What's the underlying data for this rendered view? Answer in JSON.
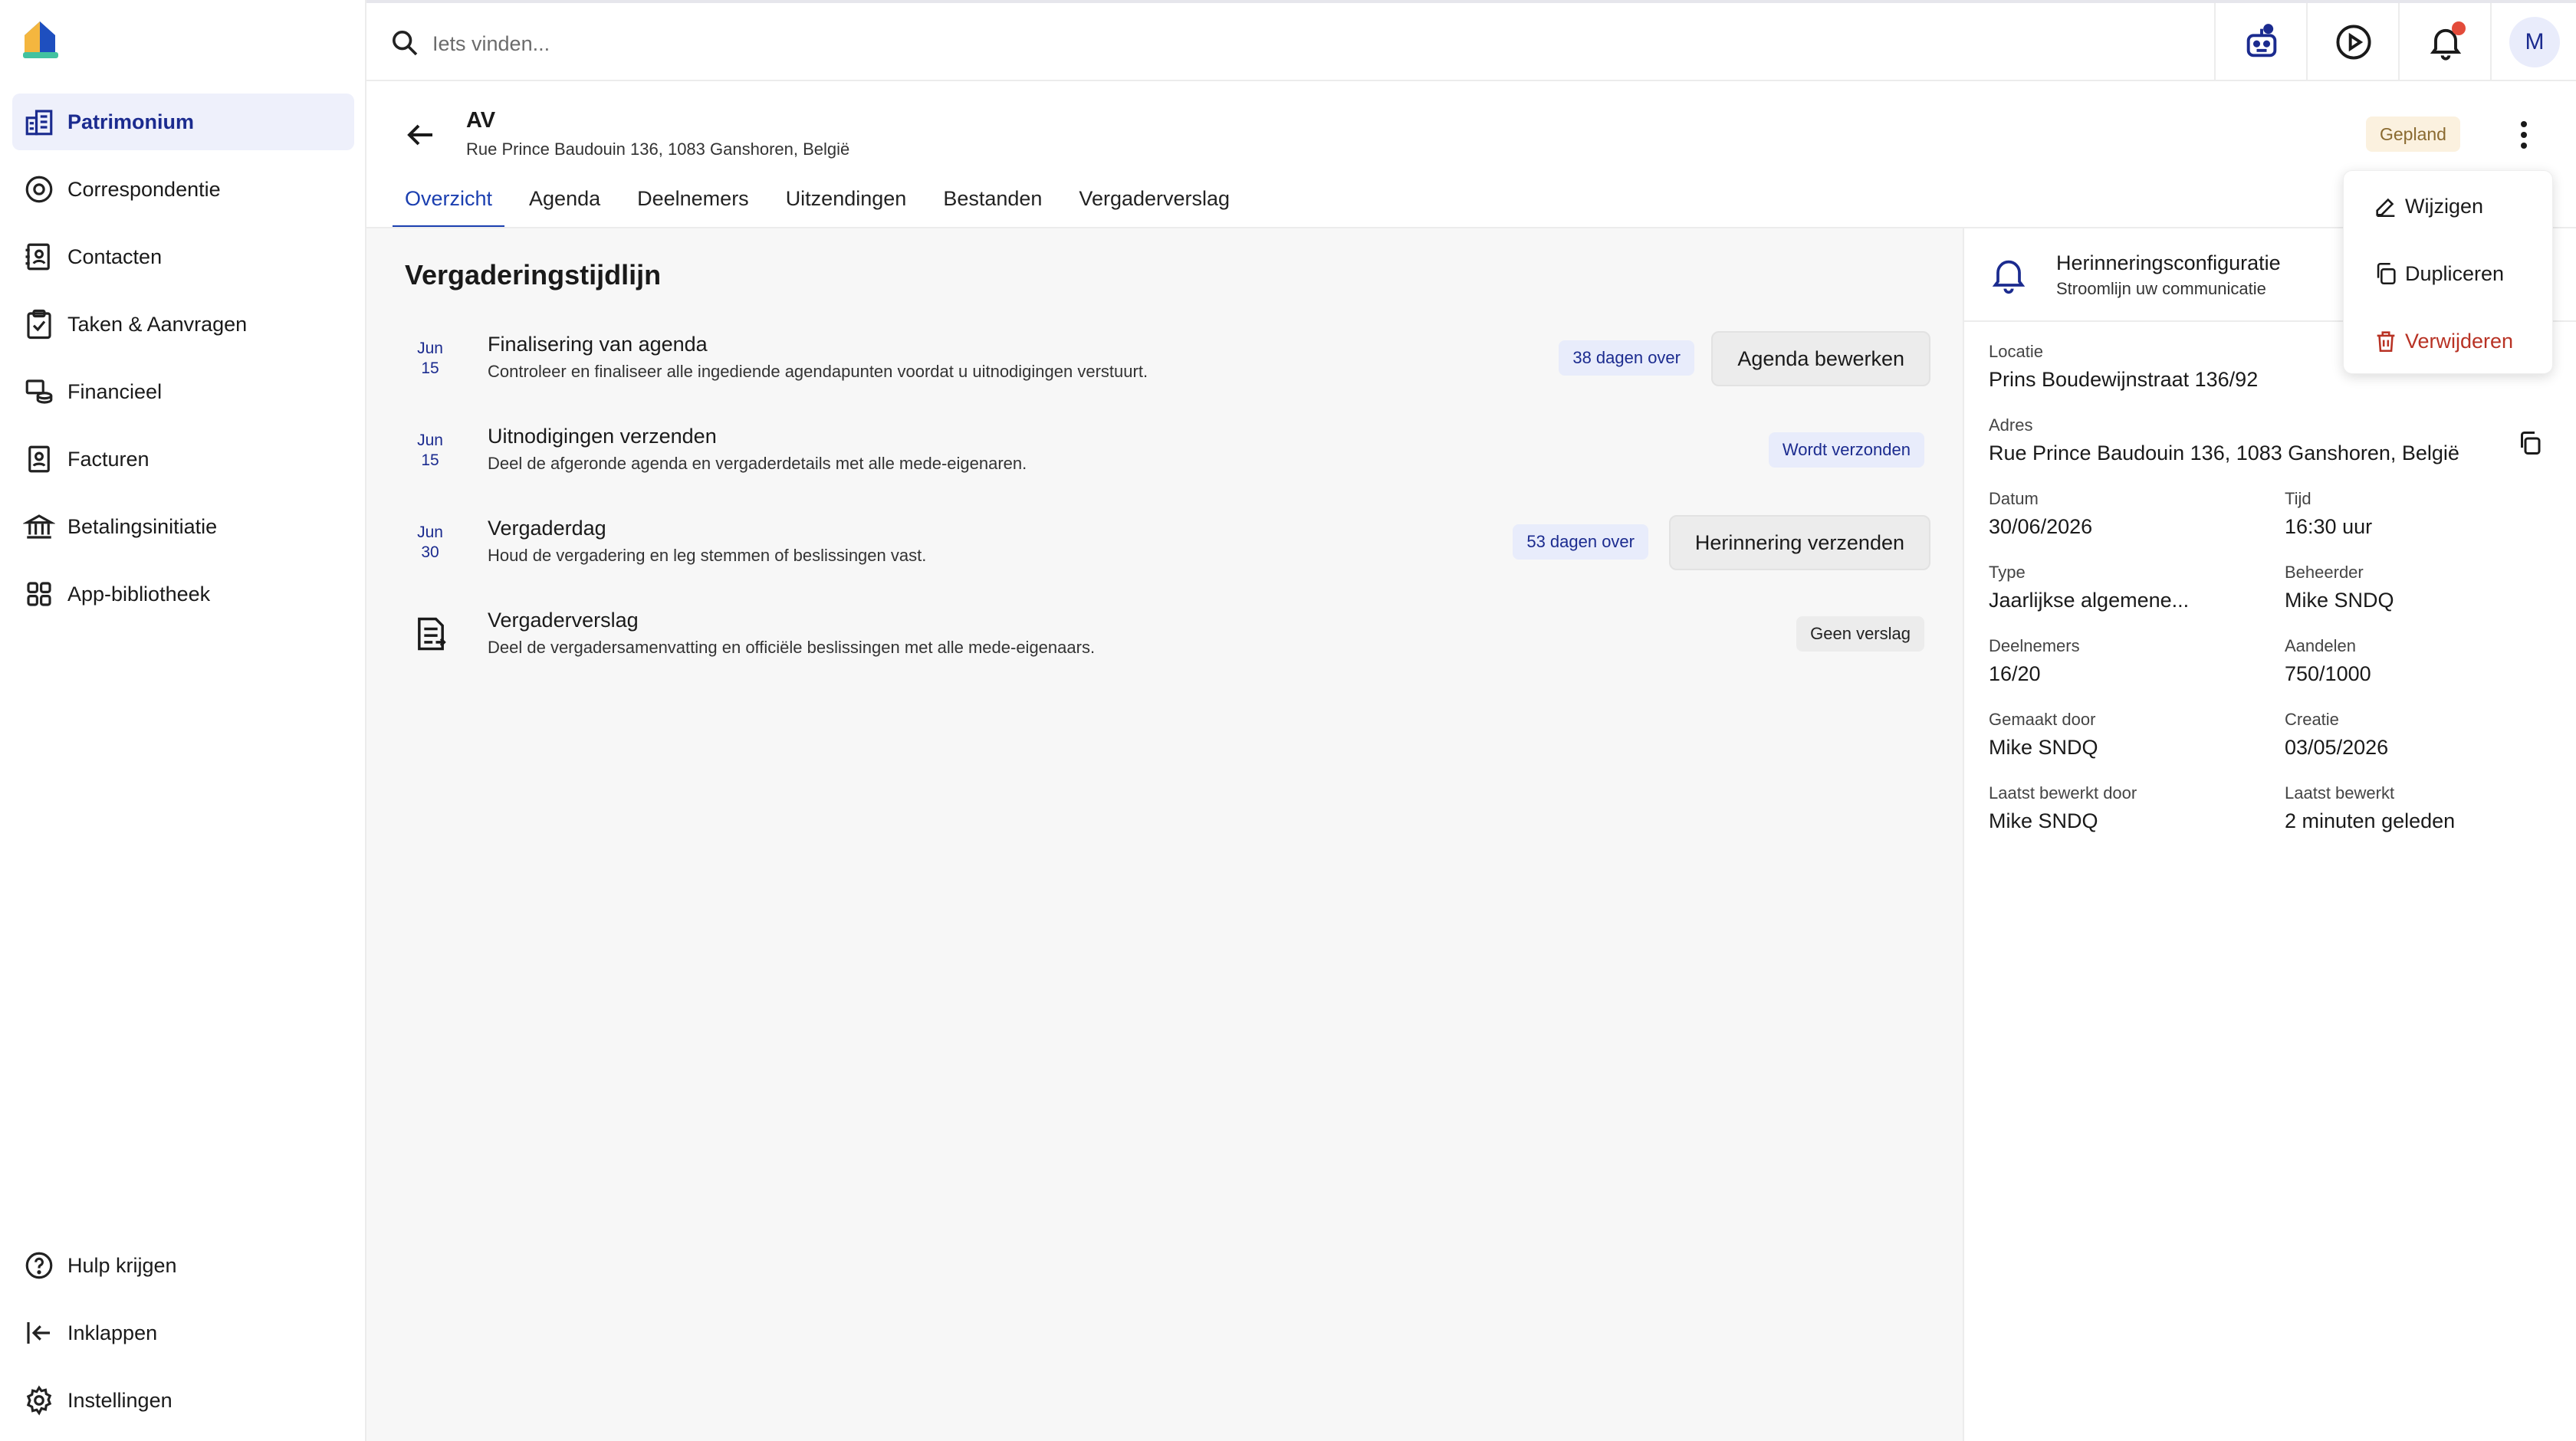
{
  "sidebar": {
    "items": [
      {
        "label": "Patrimonium",
        "icon": "building-chart-icon"
      },
      {
        "label": "Correspondentie",
        "icon": "at-icon"
      },
      {
        "label": "Contacten",
        "icon": "contacts-book-icon"
      },
      {
        "label": "Taken & Aanvragen",
        "icon": "clipboard-check-icon"
      },
      {
        "label": "Financieel",
        "icon": "coins-icon"
      },
      {
        "label": "Facturen",
        "icon": "invoice-icon"
      },
      {
        "label": "Betalingsinitiatie",
        "icon": "bank-icon"
      },
      {
        "label": "App-bibliotheek",
        "icon": "apps-grid-icon"
      }
    ],
    "bottom": [
      {
        "label": "Hulp krijgen",
        "icon": "help-icon"
      },
      {
        "label": "Inklappen",
        "icon": "collapse-icon"
      },
      {
        "label": "Instellingen",
        "icon": "gear-icon"
      }
    ]
  },
  "search": {
    "placeholder": "Iets vinden..."
  },
  "topbar": {
    "avatar_initial": "M"
  },
  "header": {
    "title": "AV",
    "subtitle": "Rue Prince Baudouin 136, 1083 Ganshoren, België",
    "status": "Gepland"
  },
  "tabs": [
    "Overzicht",
    "Agenda",
    "Deelnemers",
    "Uitzendingen",
    "Bestanden",
    "Vergaderverslag"
  ],
  "timeline": {
    "title": "Vergaderingstijdlijn",
    "items": [
      {
        "month": "Jun",
        "day": "15",
        "title": "Finalisering van agenda",
        "desc": "Controleer en finaliseer alle ingediende agendapunten voordat u uitnodigingen verstuurt.",
        "badge": "38 dagen over",
        "action": "Agenda bewerken"
      },
      {
        "month": "Jun",
        "day": "15",
        "title": "Uitnodigingen verzenden",
        "desc": "Deel de afgeronde agenda en vergaderdetails met alle mede-eigenaren.",
        "badge": "Wordt verzonden"
      },
      {
        "month": "Jun",
        "day": "30",
        "title": "Vergaderdag",
        "desc": "Houd de vergadering en leg stemmen of beslissingen vast.",
        "badge": "53 dagen over",
        "action": "Herinnering verzenden"
      },
      {
        "title": "Vergaderverslag",
        "desc": "Deel de vergadersamenvatting en officiële beslissingen met alle mede-eigenaars.",
        "badge": "Geen verslag"
      }
    ]
  },
  "details": {
    "reminder_title": "Herinneringsconfiguratie",
    "reminder_sub": "Stroomlijn uw communicatie",
    "locatie": {
      "label": "Locatie",
      "value": "Prins Boudewijnstraat 136/92"
    },
    "adres": {
      "label": "Adres",
      "value": "Rue Prince Baudouin 136, 1083 Ganshoren, België"
    },
    "datum": {
      "label": "Datum",
      "value": "30/06/2026"
    },
    "tijd": {
      "label": "Tijd",
      "value": "16:30 uur"
    },
    "type": {
      "label": "Type",
      "value": "Jaarlijkse algemene..."
    },
    "beheerder": {
      "label": "Beheerder",
      "value": "Mike SNDQ"
    },
    "deelnemers": {
      "label": "Deelnemers",
      "value": "16/20"
    },
    "aandelen": {
      "label": "Aandelen",
      "value": "750/1000"
    },
    "gemaakt_door": {
      "label": "Gemaakt door",
      "value": "Mike SNDQ"
    },
    "creatie": {
      "label": "Creatie",
      "value": "03/05/2026"
    },
    "laatst_bewerkt_door": {
      "label": "Laatst bewerkt door",
      "value": "Mike SNDQ"
    },
    "laatst_bewerkt": {
      "label": "Laatst bewerkt",
      "value": "2 minuten geleden"
    }
  },
  "menu": {
    "edit": "Wijzigen",
    "duplicate": "Dupliceren",
    "delete": "Verwijderen"
  },
  "colors": {
    "accent": "#1b2b8f",
    "danger": "#b83224",
    "status_bg": "#fbf1df"
  }
}
